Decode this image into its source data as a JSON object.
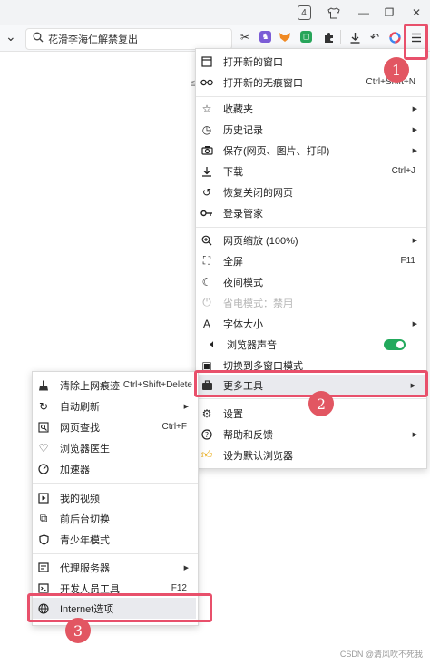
{
  "titlebar": {
    "tab_count": "4",
    "shirt_icon": "shirt-icon",
    "minimize_glyph": "—",
    "restore_glyph": "❐",
    "close_glyph": "✕"
  },
  "toolbar": {
    "address_text": "花滑李海仁解禁复出",
    "dropdown_glyph": "⌄"
  },
  "page_edge_text": "≦",
  "main_menu": {
    "items": [
      {
        "label": "打开新的窗口",
        "shortcut": "",
        "icon": "window-icon"
      },
      {
        "label": "打开新的无痕窗口",
        "shortcut": "Ctrl+Shift+N",
        "icon": "incognito-icon"
      },
      {
        "label": "收藏夹",
        "shortcut": "",
        "icon": "star-icon"
      },
      {
        "label": "历史记录",
        "shortcut": "",
        "icon": "history-icon"
      },
      {
        "label": "保存(网页、图片、打印)",
        "shortcut": "",
        "icon": "camera-icon"
      },
      {
        "label": "下载",
        "shortcut": "Ctrl+J",
        "icon": "download-icon"
      },
      {
        "label": "恢复关闭的网页",
        "shortcut": "",
        "icon": "restore-icon"
      },
      {
        "label": "登录管家",
        "shortcut": "",
        "icon": "key-icon"
      },
      {
        "label": "网页缩放 (100%)",
        "shortcut": "",
        "icon": "zoom-icon"
      },
      {
        "label": "全屏",
        "shortcut": "F11",
        "icon": "fullscreen-icon"
      },
      {
        "label": "夜间模式",
        "shortcut": "",
        "icon": "moon-icon"
      },
      {
        "label": "省电模式：禁用",
        "shortcut": "",
        "icon": "power-save-icon"
      },
      {
        "label": "字体大小",
        "shortcut": "",
        "icon": "font-size-icon"
      },
      {
        "label": "浏览器声音",
        "shortcut": "",
        "icon": "speaker-icon"
      },
      {
        "label": "切换到多窗口模式",
        "shortcut": "",
        "icon": "multi-window-icon"
      },
      {
        "label": "更多工具",
        "shortcut": "",
        "icon": "toolbox-icon"
      },
      {
        "label": "设置",
        "shortcut": "",
        "icon": "settings-gear-icon"
      },
      {
        "label": "帮助和反馈",
        "shortcut": "",
        "icon": "help-icon"
      },
      {
        "label": "设为默认浏览器",
        "shortcut": "",
        "icon": "thumbs-up-icon"
      }
    ]
  },
  "sub_menu": {
    "items": [
      {
        "label": "清除上网痕迹",
        "shortcut": "Ctrl+Shift+Delete",
        "icon": "broom-icon"
      },
      {
        "label": "自动刷新",
        "shortcut": "",
        "icon": "refresh-icon"
      },
      {
        "label": "网页查找",
        "shortcut": "Ctrl+F",
        "icon": "find-icon"
      },
      {
        "label": "浏览器医生",
        "shortcut": "",
        "icon": "doctor-icon"
      },
      {
        "label": "加速器",
        "shortcut": "",
        "icon": "speedometer-icon"
      },
      {
        "label": "我的视频",
        "shortcut": "",
        "icon": "video-icon"
      },
      {
        "label": "前后台切换",
        "shortcut": "",
        "icon": "switch-icon"
      },
      {
        "label": "青少年模式",
        "shortcut": "",
        "icon": "shield-icon"
      },
      {
        "label": "代理服务器",
        "shortcut": "",
        "icon": "proxy-icon"
      },
      {
        "label": "开发人员工具",
        "shortcut": "F12",
        "icon": "devtools-icon"
      },
      {
        "label": "Internet选项",
        "shortcut": "",
        "icon": "globe-icon"
      }
    ]
  },
  "annotations": {
    "step1": "1",
    "step2": "2",
    "step3": "3"
  },
  "watermark": "CSDN @清风吹不死我",
  "colors": {
    "highlight_box": "#e8506b",
    "badge": "#e25662",
    "toggle_on": "#22a95c"
  }
}
